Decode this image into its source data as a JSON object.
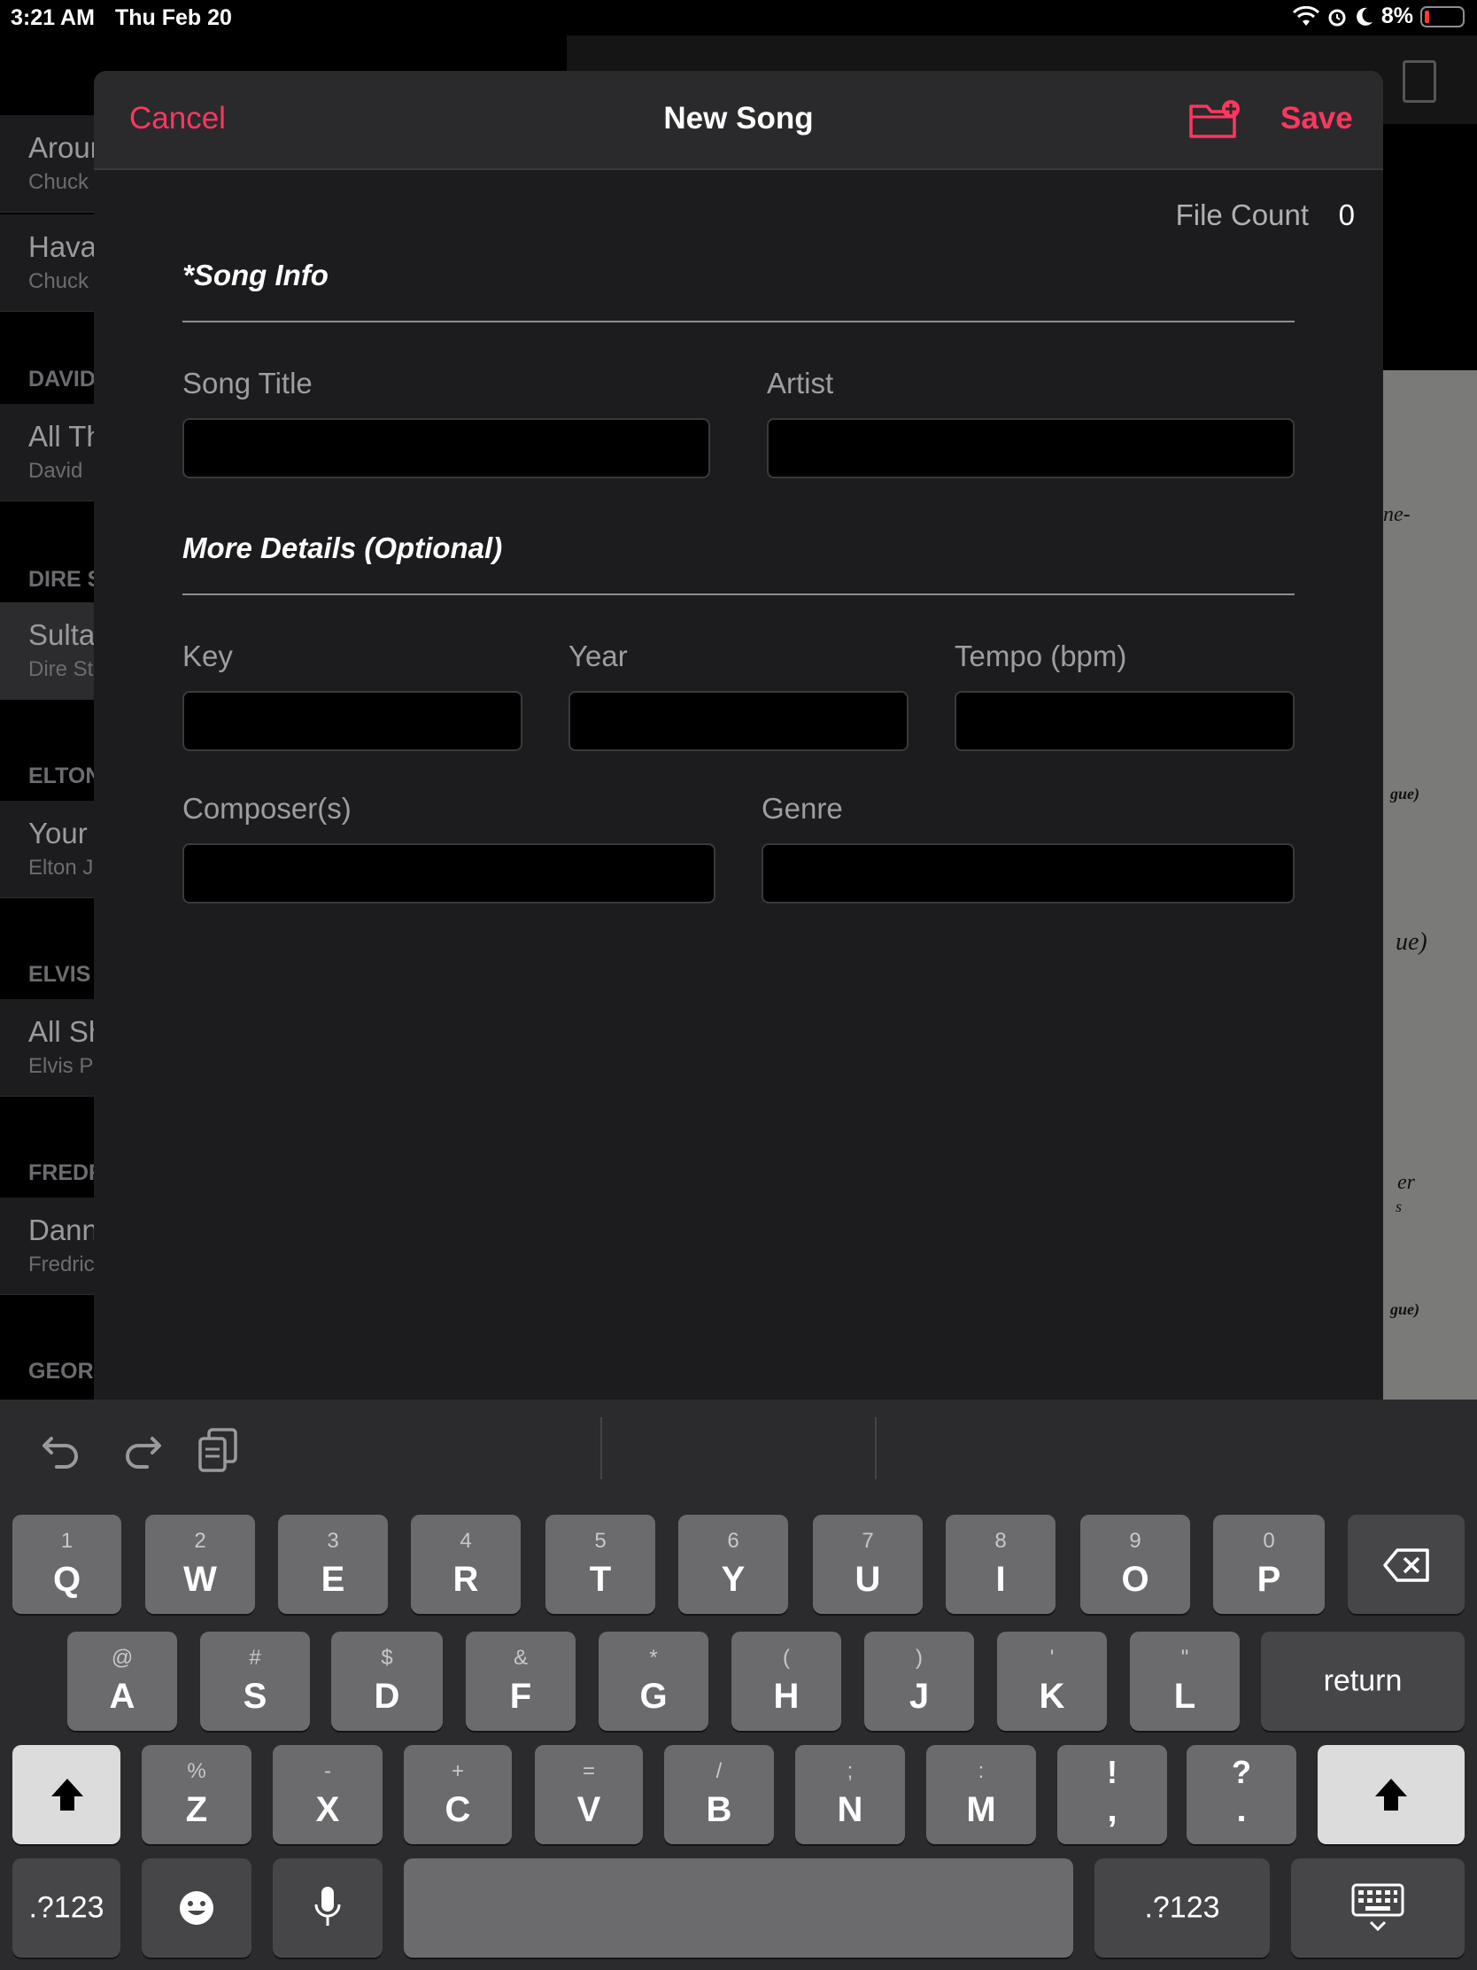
{
  "status": {
    "time": "3:21 AM",
    "date": "Thu Feb 20",
    "battery": "8%"
  },
  "background": {
    "list": [
      {
        "title": "Around",
        "subtitle": "Chuck"
      },
      {
        "title": "Havana",
        "subtitle": "Chuck"
      },
      {
        "header": "DAVID"
      },
      {
        "title": "All Th",
        "subtitle": "David"
      },
      {
        "header": "DIRE S"
      },
      {
        "title": "Sultans",
        "subtitle": "Dire St"
      },
      {
        "header": "ELTON"
      },
      {
        "title": "Your",
        "subtitle": "Elton J"
      },
      {
        "header": "ELVIS"
      },
      {
        "title": "All Sh",
        "subtitle": "Elvis P"
      },
      {
        "header": "FREDR"
      },
      {
        "title": "Dann",
        "subtitle": "Fredric"
      },
      {
        "header": "GEOR"
      }
    ],
    "paper_fragments": [
      "ne-",
      "gue)",
      "ue)",
      "er",
      "s",
      "gue)"
    ]
  },
  "modal": {
    "cancel_label": "Cancel",
    "title": "New Song",
    "save_label": "Save",
    "file_count_label": "File Count",
    "file_count_value": "0",
    "section_song_info": "*Song Info",
    "section_more_details": "More Details (Optional)",
    "fields": {
      "song_title": {
        "label": "Song Title",
        "value": ""
      },
      "artist": {
        "label": "Artist",
        "value": ""
      },
      "key": {
        "label": "Key",
        "value": ""
      },
      "year": {
        "label": "Year",
        "value": ""
      },
      "tempo": {
        "label": "Tempo (bpm)",
        "value": ""
      },
      "composers": {
        "label": "Composer(s)",
        "value": ""
      },
      "genre": {
        "label": "Genre",
        "value": ""
      }
    }
  },
  "keyboard": {
    "row1": [
      {
        "main": "Q",
        "sub": "1"
      },
      {
        "main": "W",
        "sub": "2"
      },
      {
        "main": "E",
        "sub": "3"
      },
      {
        "main": "R",
        "sub": "4"
      },
      {
        "main": "T",
        "sub": "5"
      },
      {
        "main": "Y",
        "sub": "6"
      },
      {
        "main": "U",
        "sub": "7"
      },
      {
        "main": "I",
        "sub": "8"
      },
      {
        "main": "O",
        "sub": "9"
      },
      {
        "main": "P",
        "sub": "0"
      }
    ],
    "row2": [
      {
        "main": "A",
        "sub": "@"
      },
      {
        "main": "S",
        "sub": "#"
      },
      {
        "main": "D",
        "sub": "$"
      },
      {
        "main": "F",
        "sub": "&"
      },
      {
        "main": "G",
        "sub": "*"
      },
      {
        "main": "H",
        "sub": "("
      },
      {
        "main": "J",
        "sub": ")"
      },
      {
        "main": "K",
        "sub": "'"
      },
      {
        "main": "L",
        "sub": "\""
      }
    ],
    "row3": [
      {
        "main": "Z",
        "sub": "%"
      },
      {
        "main": "X",
        "sub": "-"
      },
      {
        "main": "C",
        "sub": "+"
      },
      {
        "main": "V",
        "sub": "="
      },
      {
        "main": "B",
        "sub": "/"
      },
      {
        "main": "N",
        "sub": ";"
      },
      {
        "main": "M",
        "sub": ":"
      },
      {
        "main": ",",
        "sub": "!"
      },
      {
        "main": ".",
        "sub": "?"
      }
    ],
    "return_label": "return",
    "numbers_label": ".?123"
  }
}
